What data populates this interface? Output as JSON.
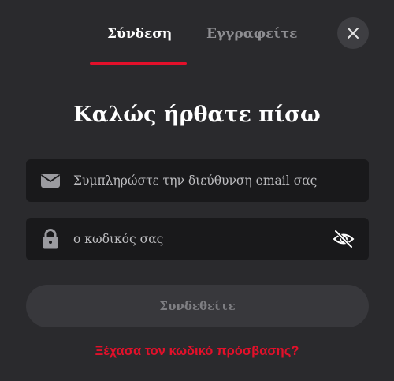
{
  "tabs": {
    "login_label": "Σύνδεση",
    "register_label": "Εγγραφείτε",
    "active": "login"
  },
  "close_icon": "close-icon",
  "heading": "Καλώς ήρθατε πίσω",
  "email_field": {
    "icon": "envelope-icon",
    "placeholder": "Συμπληρώστε την διεύθυνση email σας",
    "value": ""
  },
  "password_field": {
    "icon": "lock-icon",
    "placeholder": "ο κωδικός σας",
    "value": "",
    "toggle_icon": "eye-off-icon"
  },
  "submit": {
    "label": "Συνδεθείτε"
  },
  "forgot_link": "Ξέχασα τον κωδικό πρόσβασης?",
  "colors": {
    "accent": "#e3102a",
    "background": "#2a2a2d",
    "field_background": "#19191b",
    "button_background": "#38383c"
  }
}
